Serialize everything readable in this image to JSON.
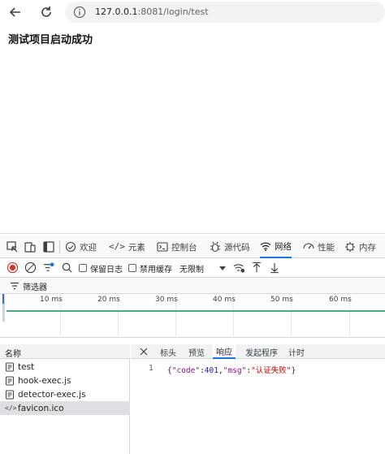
{
  "browser": {
    "url_host": "127.0.0.1",
    "url_rest": ":8081/login/test",
    "back_icon": "arrow-left-icon",
    "reload_icon": "reload-icon",
    "info_icon": "info-icon"
  },
  "page": {
    "heading": "测试项目启动成功"
  },
  "devtools": {
    "tabs": [
      {
        "label": "欢迎",
        "icon": "home-icon"
      },
      {
        "label": "元素",
        "icon": "code-icon"
      },
      {
        "label": "控制台",
        "icon": "console-icon"
      },
      {
        "label": "源代码",
        "icon": "bug-icon"
      },
      {
        "label": "网络",
        "icon": "wifi-icon",
        "active": true
      },
      {
        "label": "性能",
        "icon": "performance-icon"
      },
      {
        "label": "内存",
        "icon": "memory-icon"
      }
    ],
    "toolbar": {
      "preserve_log": "保留日志",
      "disable_cache": "禁用缓存",
      "throttle": "无限制"
    },
    "filter": {
      "label": "筛选器"
    },
    "timeline": {
      "ticks": [
        "10 ms",
        "20 ms",
        "30 ms",
        "40 ms",
        "50 ms",
        "60 ms"
      ]
    },
    "list": {
      "header": "名称",
      "rows": [
        {
          "name": "test",
          "icon": "document-icon"
        },
        {
          "name": "hook-exec.js",
          "icon": "script-icon"
        },
        {
          "name": "detector-exec.js",
          "icon": "script-icon"
        },
        {
          "name": "favicon.ico",
          "icon": "code-file-icon",
          "selected": true
        }
      ]
    },
    "response_tabs": [
      "标头",
      "预览",
      "响应",
      "发起程序",
      "计时"
    ],
    "response_active": "响应",
    "response": {
      "line_number": "1",
      "key1": "\"code\"",
      "val1": "401",
      "key2": "\"msg\"",
      "val2": "\"认证失败\""
    }
  },
  "colors": {
    "accent": "#1a73e8",
    "record_red": "#d93025",
    "timeline_green": "#4caf7d"
  }
}
